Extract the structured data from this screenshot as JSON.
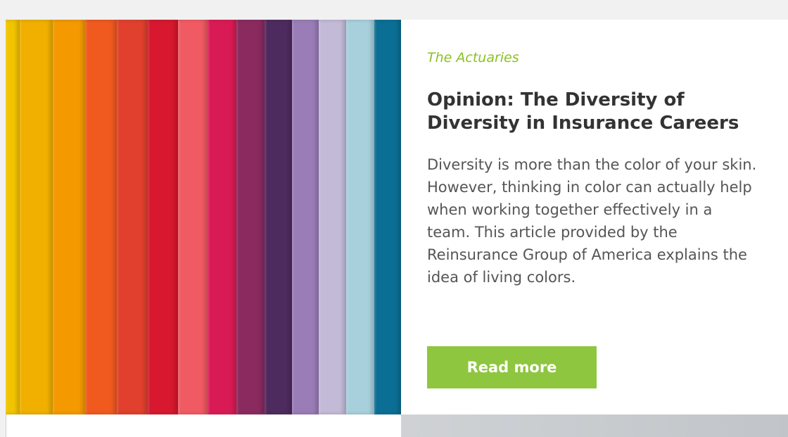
{
  "article": {
    "source": "The Actuaries",
    "headline": "Opinion: The Diversity of Diversity in Insurance Careers",
    "summary": "Diversity is more than the color of your skin. However, thinking in color can actually help when working together effectively in a team. This article provided by the Reinsurance Group of America explains the idea of living colors.",
    "button_label": "Read more"
  },
  "colors": {
    "accent": "#8ec63f",
    "source_text": "#8bc024",
    "headline_text": "#333333",
    "body_text": "#555555",
    "stripes": [
      "#f2c400",
      "#f1b000",
      "#f49a00",
      "#f05a1f",
      "#e0402d",
      "#d7182e",
      "#f05a63",
      "#d91b55",
      "#8a2a5f",
      "#4e2b5e",
      "#9a7cb7",
      "#c3bad8",
      "#a8d0dc",
      "#0b6f95"
    ]
  }
}
